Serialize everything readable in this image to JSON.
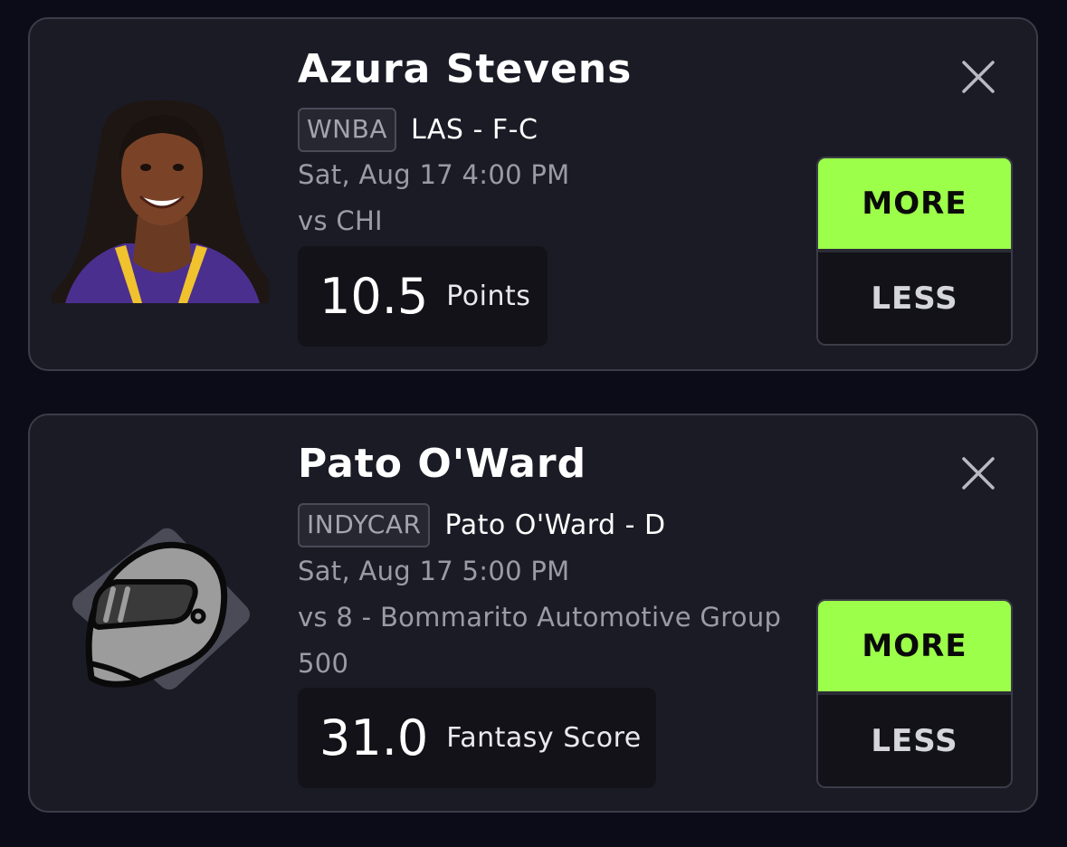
{
  "cards": [
    {
      "player_name": "Azura Stevens",
      "league": "WNBA",
      "team_position": "LAS - F-C",
      "game_time": "Sat, Aug 17 4:00 PM",
      "opponent": "vs CHI",
      "line_value": "10.5",
      "stat_type": "Points",
      "more_label": "MORE",
      "less_label": "LESS",
      "avatar_icon": "player-photo"
    },
    {
      "player_name": "Pato O'Ward",
      "league": "INDYCAR",
      "team_position": "Pato O'Ward - D",
      "game_time": "Sat, Aug 17 5:00 PM",
      "opponent": "vs 8 - Bommarito Automotive Group 500",
      "line_value": "31.0",
      "stat_type": "Fantasy Score",
      "more_label": "MORE",
      "less_label": "LESS",
      "avatar_icon": "racing-helmet-icon"
    }
  ],
  "colors": {
    "background": "#0b0c17",
    "card": "#1b1b26",
    "more_accent": "#9cff4a"
  }
}
